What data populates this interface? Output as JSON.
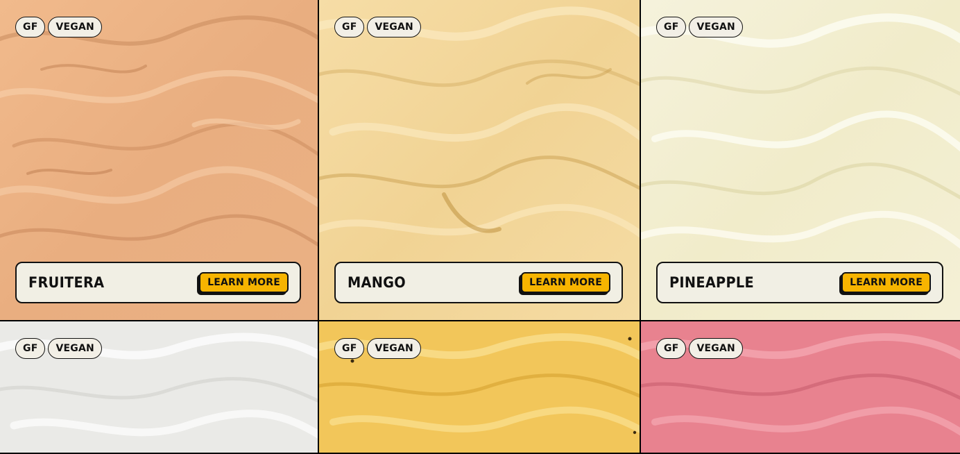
{
  "flavors": [
    {
      "name": "FRUITERA",
      "badges": [
        "GF",
        "VEGAN"
      ],
      "cta": "LEARN MORE",
      "colors": {
        "base": "#eab184",
        "light": "#f5c79d",
        "dark": "#c98a5c"
      }
    },
    {
      "name": "MANGO",
      "badges": [
        "GF",
        "VEGAN"
      ],
      "cta": "LEARN MORE",
      "colors": {
        "base": "#f3d9a0",
        "light": "#fbe9bd",
        "dark": "#d9b56a"
      }
    },
    {
      "name": "PINEAPPLE",
      "badges": [
        "GF",
        "VEGAN"
      ],
      "cta": "LEARN MORE",
      "colors": {
        "base": "#f3efd2",
        "light": "#fbf9ea",
        "dark": "#ddd6ae"
      }
    },
    {
      "badges": [
        "GF",
        "VEGAN"
      ],
      "colors": {
        "base": "#ecebe8",
        "light": "#fafafa",
        "dark": "#cfcfcc"
      }
    },
    {
      "badges": [
        "GF",
        "VEGAN"
      ],
      "colors": {
        "base": "#f2c75b",
        "light": "#f8dc87",
        "dark": "#d9a530"
      }
    },
    {
      "badges": [
        "GF",
        "VEGAN"
      ],
      "colors": {
        "base": "#e98391",
        "light": "#f3a3ad",
        "dark": "#c9606f"
      }
    }
  ]
}
